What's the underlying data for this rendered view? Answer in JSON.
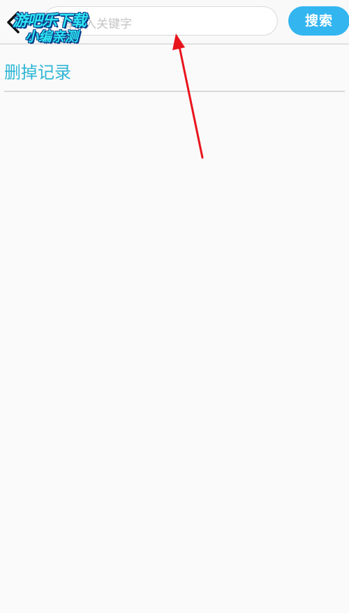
{
  "header": {
    "search_placeholder": "请输入关键字",
    "search_button": "搜索"
  },
  "watermark": {
    "line1": "游吧乐下载",
    "line2": "小编亲测"
  },
  "history": {
    "delete_label": "删掉记录"
  },
  "colors": {
    "accent": "#33b5f0",
    "link": "#2fb6d6",
    "annotation_arrow": "#e8141c"
  }
}
